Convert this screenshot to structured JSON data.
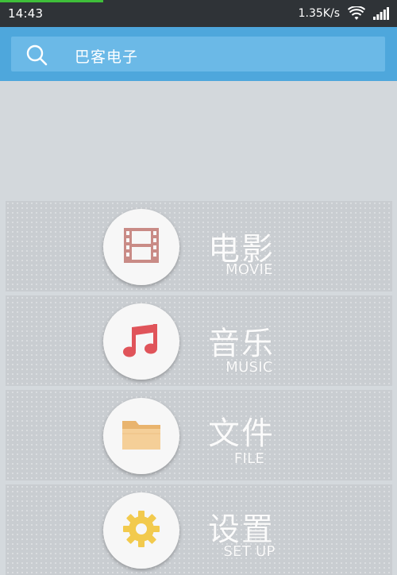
{
  "status_bar": {
    "time": "14:43",
    "network_speed": "1.35K/s",
    "wifi_icon": "wifi-icon",
    "signal_icon": "signal-bars-icon",
    "load_progress": 0.26,
    "background": "#2f3337"
  },
  "search": {
    "text": "巴客电子",
    "icon": "search-icon",
    "header_color": "#4ea7dc",
    "box_color": "#6bb9e7"
  },
  "menu": {
    "items": [
      {
        "label_zh": "电影",
        "label_en": "MOVIE",
        "icon": "film-icon",
        "icon_color": "#c98b86"
      },
      {
        "label_zh": "音乐",
        "label_en": "MUSIC",
        "icon": "music-note-icon",
        "icon_color": "#e0545a"
      },
      {
        "label_zh": "文件",
        "label_en": "FILE",
        "icon": "folder-icon",
        "icon_color": "#f2c88e"
      },
      {
        "label_zh": "设置",
        "label_en": "SET UP",
        "icon": "gear-icon",
        "icon_color": "#f2ca4d"
      }
    ]
  }
}
